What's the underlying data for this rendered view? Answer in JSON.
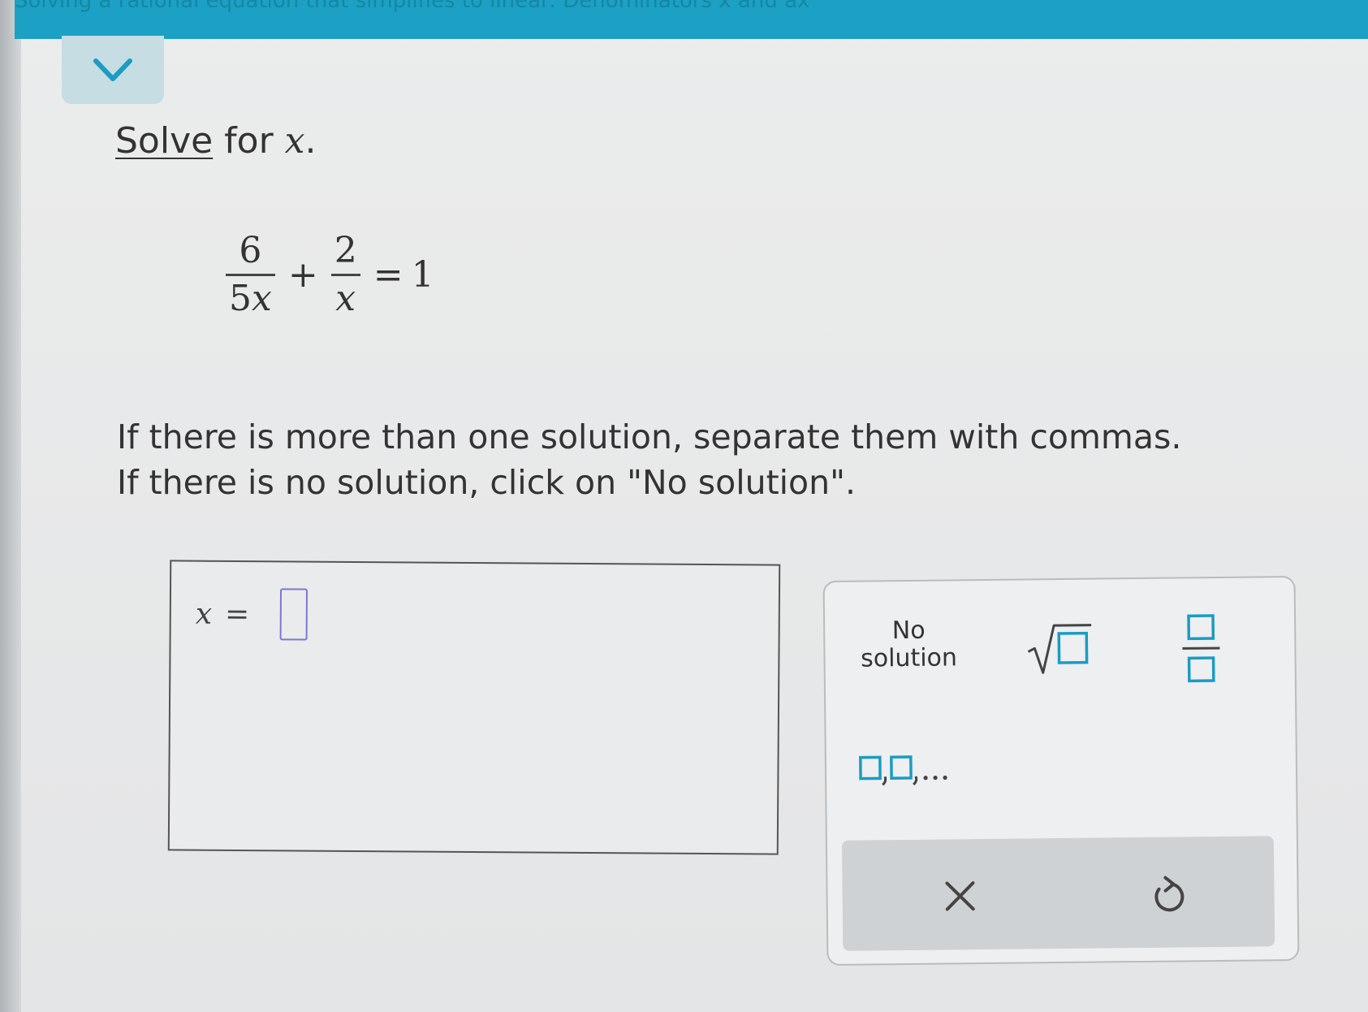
{
  "header": {
    "banner_text": "Solving a rational equation that simplifies to linear: Denominators x and ax",
    "collapse_icon": "chevron-down-icon"
  },
  "question": {
    "link_word": "Solve",
    "prompt_rest": " for ",
    "variable": "x",
    "prompt_end": ".",
    "equation": {
      "term1_num": "6",
      "term1_den_coef": "5",
      "term1_den_var": "x",
      "op": "+",
      "term2_num": "2",
      "term2_den_var": "x",
      "equals": "=",
      "rhs": "1"
    },
    "instructions_line1": "If there is more than one solution, separate them with commas.",
    "instructions_line2": "If there is no solution, click on \"No solution\"."
  },
  "answer": {
    "label_var": "x",
    "label_eq": "=",
    "value": ""
  },
  "palette": {
    "no_solution_line1": "No",
    "no_solution_line2": "solution",
    "sqrt_icon": "square-root-icon",
    "fraction_icon": "fraction-icon",
    "list_icon": "comma-list-icon",
    "clear_icon": "close-icon",
    "undo_icon": "undo-icon"
  },
  "colors": {
    "banner": "#1ca0c4",
    "collapse_tab": "#c5dde3",
    "chevron": "#1a9cc4",
    "input_border": "#7a7ad0"
  }
}
